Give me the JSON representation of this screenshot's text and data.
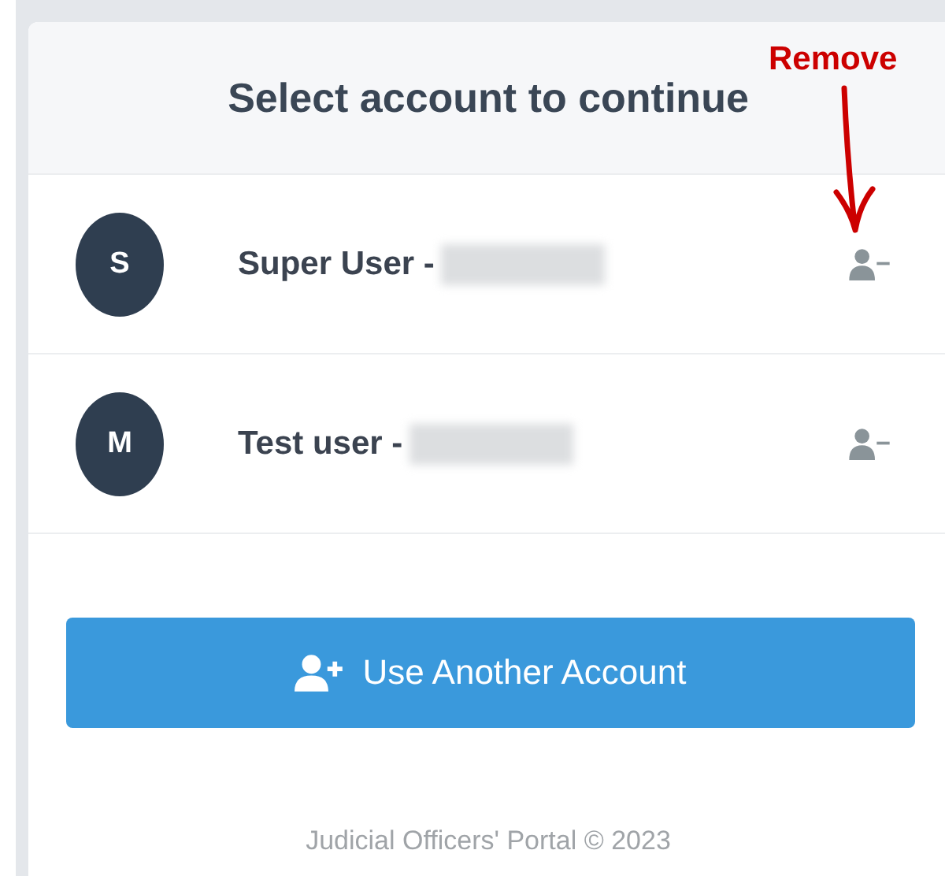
{
  "header": {
    "title": "Select account to continue"
  },
  "accounts": [
    {
      "initial": "S",
      "name": "Super User -",
      "redacted": true
    },
    {
      "initial": "M",
      "name": "Test user -",
      "redacted": true
    }
  ],
  "annotation": {
    "label": "Remove"
  },
  "add_button": {
    "label": "Use Another Account"
  },
  "footer": {
    "text": "Judicial Officers' Portal © 2023"
  }
}
